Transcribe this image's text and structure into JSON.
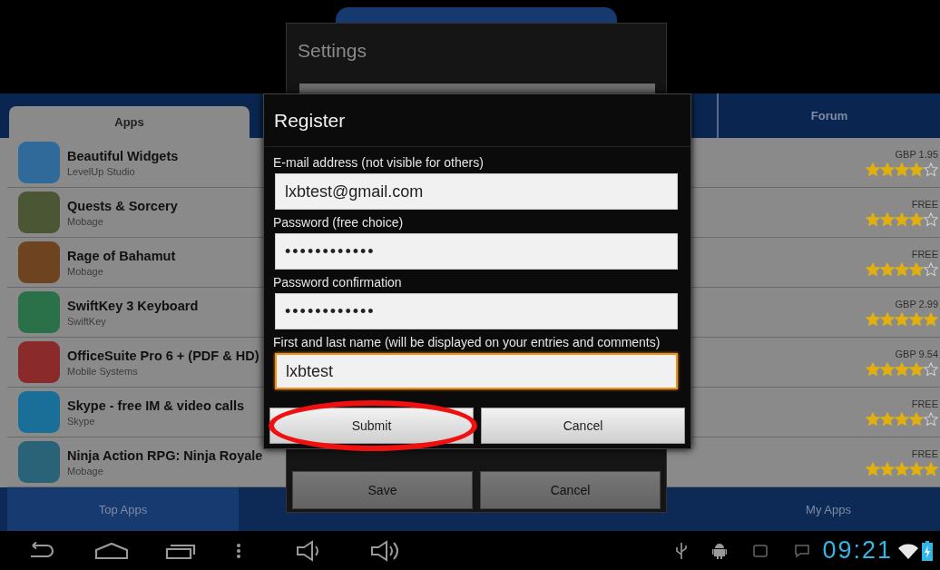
{
  "top_tabs": [
    {
      "label": "Apps",
      "selected": true
    },
    {
      "label": "Forum",
      "selected": false
    }
  ],
  "apps": [
    {
      "name": "Beautiful Widgets",
      "developer": "LevelUp Studio",
      "price": "GBP 1.95",
      "stars": 4,
      "color": "#2f6a9a"
    },
    {
      "name": "Quests & Sorcery",
      "developer": "Mobage",
      "price": "FREE",
      "stars": 4,
      "color": "#4a5634"
    },
    {
      "name": "Rage of Bahamut",
      "developer": "Mobage",
      "price": "FREE",
      "stars": 4,
      "color": "#6e4420"
    },
    {
      "name": "SwiftKey 3 Keyboard",
      "developer": "SwiftKey",
      "price": "GBP 2.99",
      "stars": 5,
      "color": "#2a7048"
    },
    {
      "name": "OfficeSuite Pro 6 + (PDF & HD)",
      "developer": "Mobile Systems",
      "price": "GBP 9.54",
      "stars": 4,
      "color": "#8a2a2a"
    },
    {
      "name": "Skype - free IM & video calls",
      "developer": "Skype",
      "price": "FREE",
      "stars": 4,
      "color": "#1a6f98"
    },
    {
      "name": "Ninja Action RPG: Ninja Royale",
      "developer": "Mobage",
      "price": "FREE",
      "stars": 5,
      "color": "#2a6378"
    }
  ],
  "bottom_tabs": [
    {
      "label": "Top Apps",
      "selected": true
    },
    {
      "label": "My Apps",
      "selected": false
    }
  ],
  "settings_dialog": {
    "title": "Settings",
    "buttons": [
      "Save",
      "Cancel"
    ]
  },
  "register_dialog": {
    "title": "Register",
    "fields": [
      {
        "label": "E-mail address (not visible for others)",
        "value": "lxbtest@gmail.com",
        "kind": "text",
        "focused": false
      },
      {
        "label": "Password (free choice)",
        "value": "••••••••••••",
        "kind": "password",
        "focused": false
      },
      {
        "label": "Password confirmation",
        "value": "••••••••••••",
        "kind": "password",
        "focused": false
      },
      {
        "label": "First and last name (will be displayed on your entries and comments)",
        "value": "lxbtest",
        "kind": "text",
        "focused": true
      }
    ],
    "buttons": [
      "Submit",
      "Cancel"
    ]
  },
  "status_bar": {
    "time": "09:21"
  }
}
